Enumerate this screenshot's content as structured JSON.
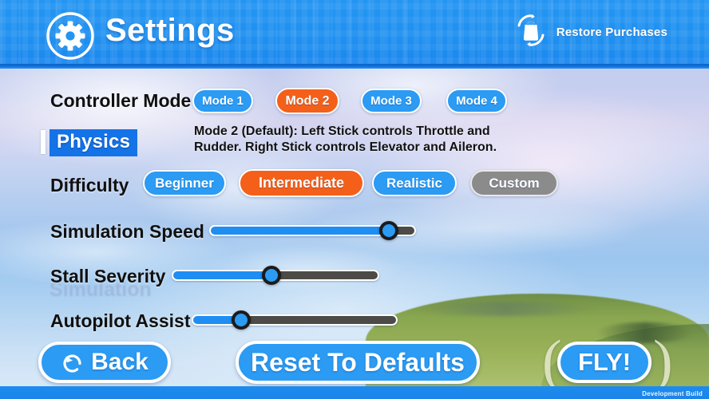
{
  "header": {
    "title": "Settings",
    "gear_icon": "gear-icon",
    "restore_label": "Restore Purchases",
    "restore_icon": "restore-purchases-bag-icon",
    "bg_color": "#2395f2"
  },
  "controller_mode": {
    "label": "Controller Mode",
    "options": [
      {
        "label": "Mode 1",
        "state": "unselected",
        "color": "#2b9bf4"
      },
      {
        "label": "Mode 2",
        "state": "selected",
        "color": "#f4601a"
      },
      {
        "label": "Mode 3",
        "state": "unselected",
        "color": "#2b9bf4"
      },
      {
        "label": "Mode 4",
        "state": "unselected",
        "color": "#2b9bf4"
      }
    ],
    "description": "Mode 2 (Default): Left Stick controls Throttle and Rudder. Right Stick controls Elevator and Aileron."
  },
  "physics_tab": {
    "label": "Physics",
    "state": "selected",
    "highlight_color": "#1573e8"
  },
  "difficulty": {
    "label": "Difficulty",
    "options": [
      {
        "label": "Beginner",
        "state": "unselected",
        "color": "#2b9bf4"
      },
      {
        "label": "Intermediate",
        "state": "selected",
        "color": "#f4601a"
      },
      {
        "label": "Realistic",
        "state": "unselected",
        "color": "#2b9bf4"
      },
      {
        "label": "Custom",
        "state": "disabled",
        "color": "#8b8b8b"
      }
    ]
  },
  "sliders": [
    {
      "label": "Simulation Speed",
      "value_percent": 87
    },
    {
      "label": "Stall Severity",
      "value_percent": 48
    },
    {
      "label": "Autopilot Assist",
      "value_percent": 24
    }
  ],
  "ghost_text": "Simulation",
  "buttons": {
    "back": {
      "label": "Back",
      "icon": "undo-arrow-icon"
    },
    "reset": {
      "label": "Reset To Defaults"
    },
    "fly": {
      "label": "FLY!",
      "left_bracket": "(",
      "right_bracket": ")"
    }
  },
  "footer": {
    "watermark": "Development Build"
  }
}
